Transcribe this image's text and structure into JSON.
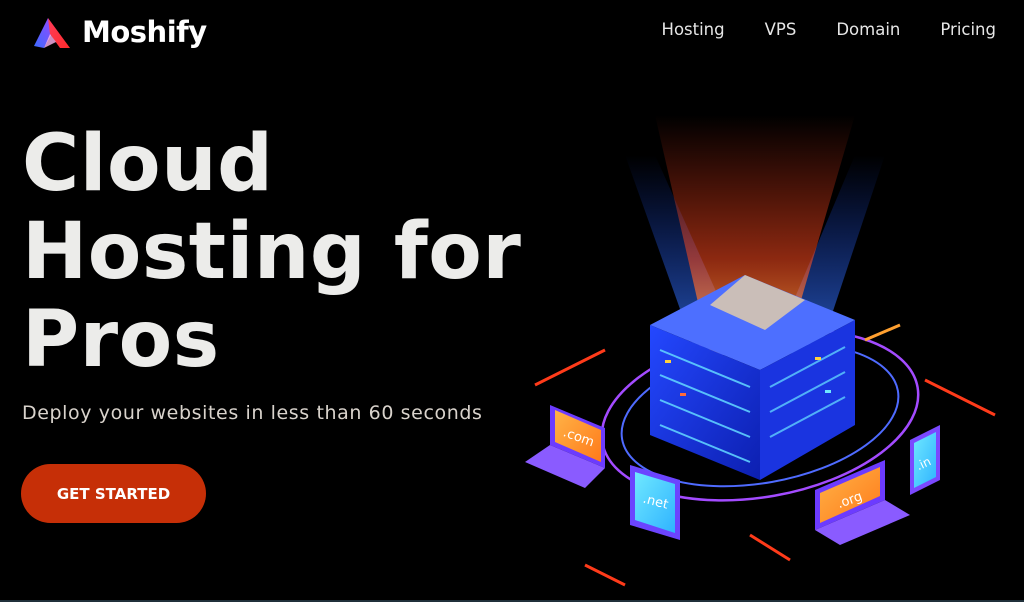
{
  "brand": {
    "name": "Moshify"
  },
  "nav": {
    "items": [
      "Hosting",
      "VPS",
      "Domain",
      "Pricing"
    ]
  },
  "hero": {
    "title_lines": [
      "Cloud",
      "Hosting for",
      "Pros"
    ],
    "subtitle": "Deploy your websites in less than 60 seconds",
    "cta_label": "GET STARTED"
  },
  "illustration": {
    "tld_labels": [
      ".com",
      ".net",
      ".org",
      ".in"
    ]
  },
  "colors": {
    "background": "#000000",
    "cta": "#c62f07",
    "server_blue": "#1f3cff",
    "accent_purple": "#9b4bff",
    "accent_orange": "#ff8a1f"
  }
}
